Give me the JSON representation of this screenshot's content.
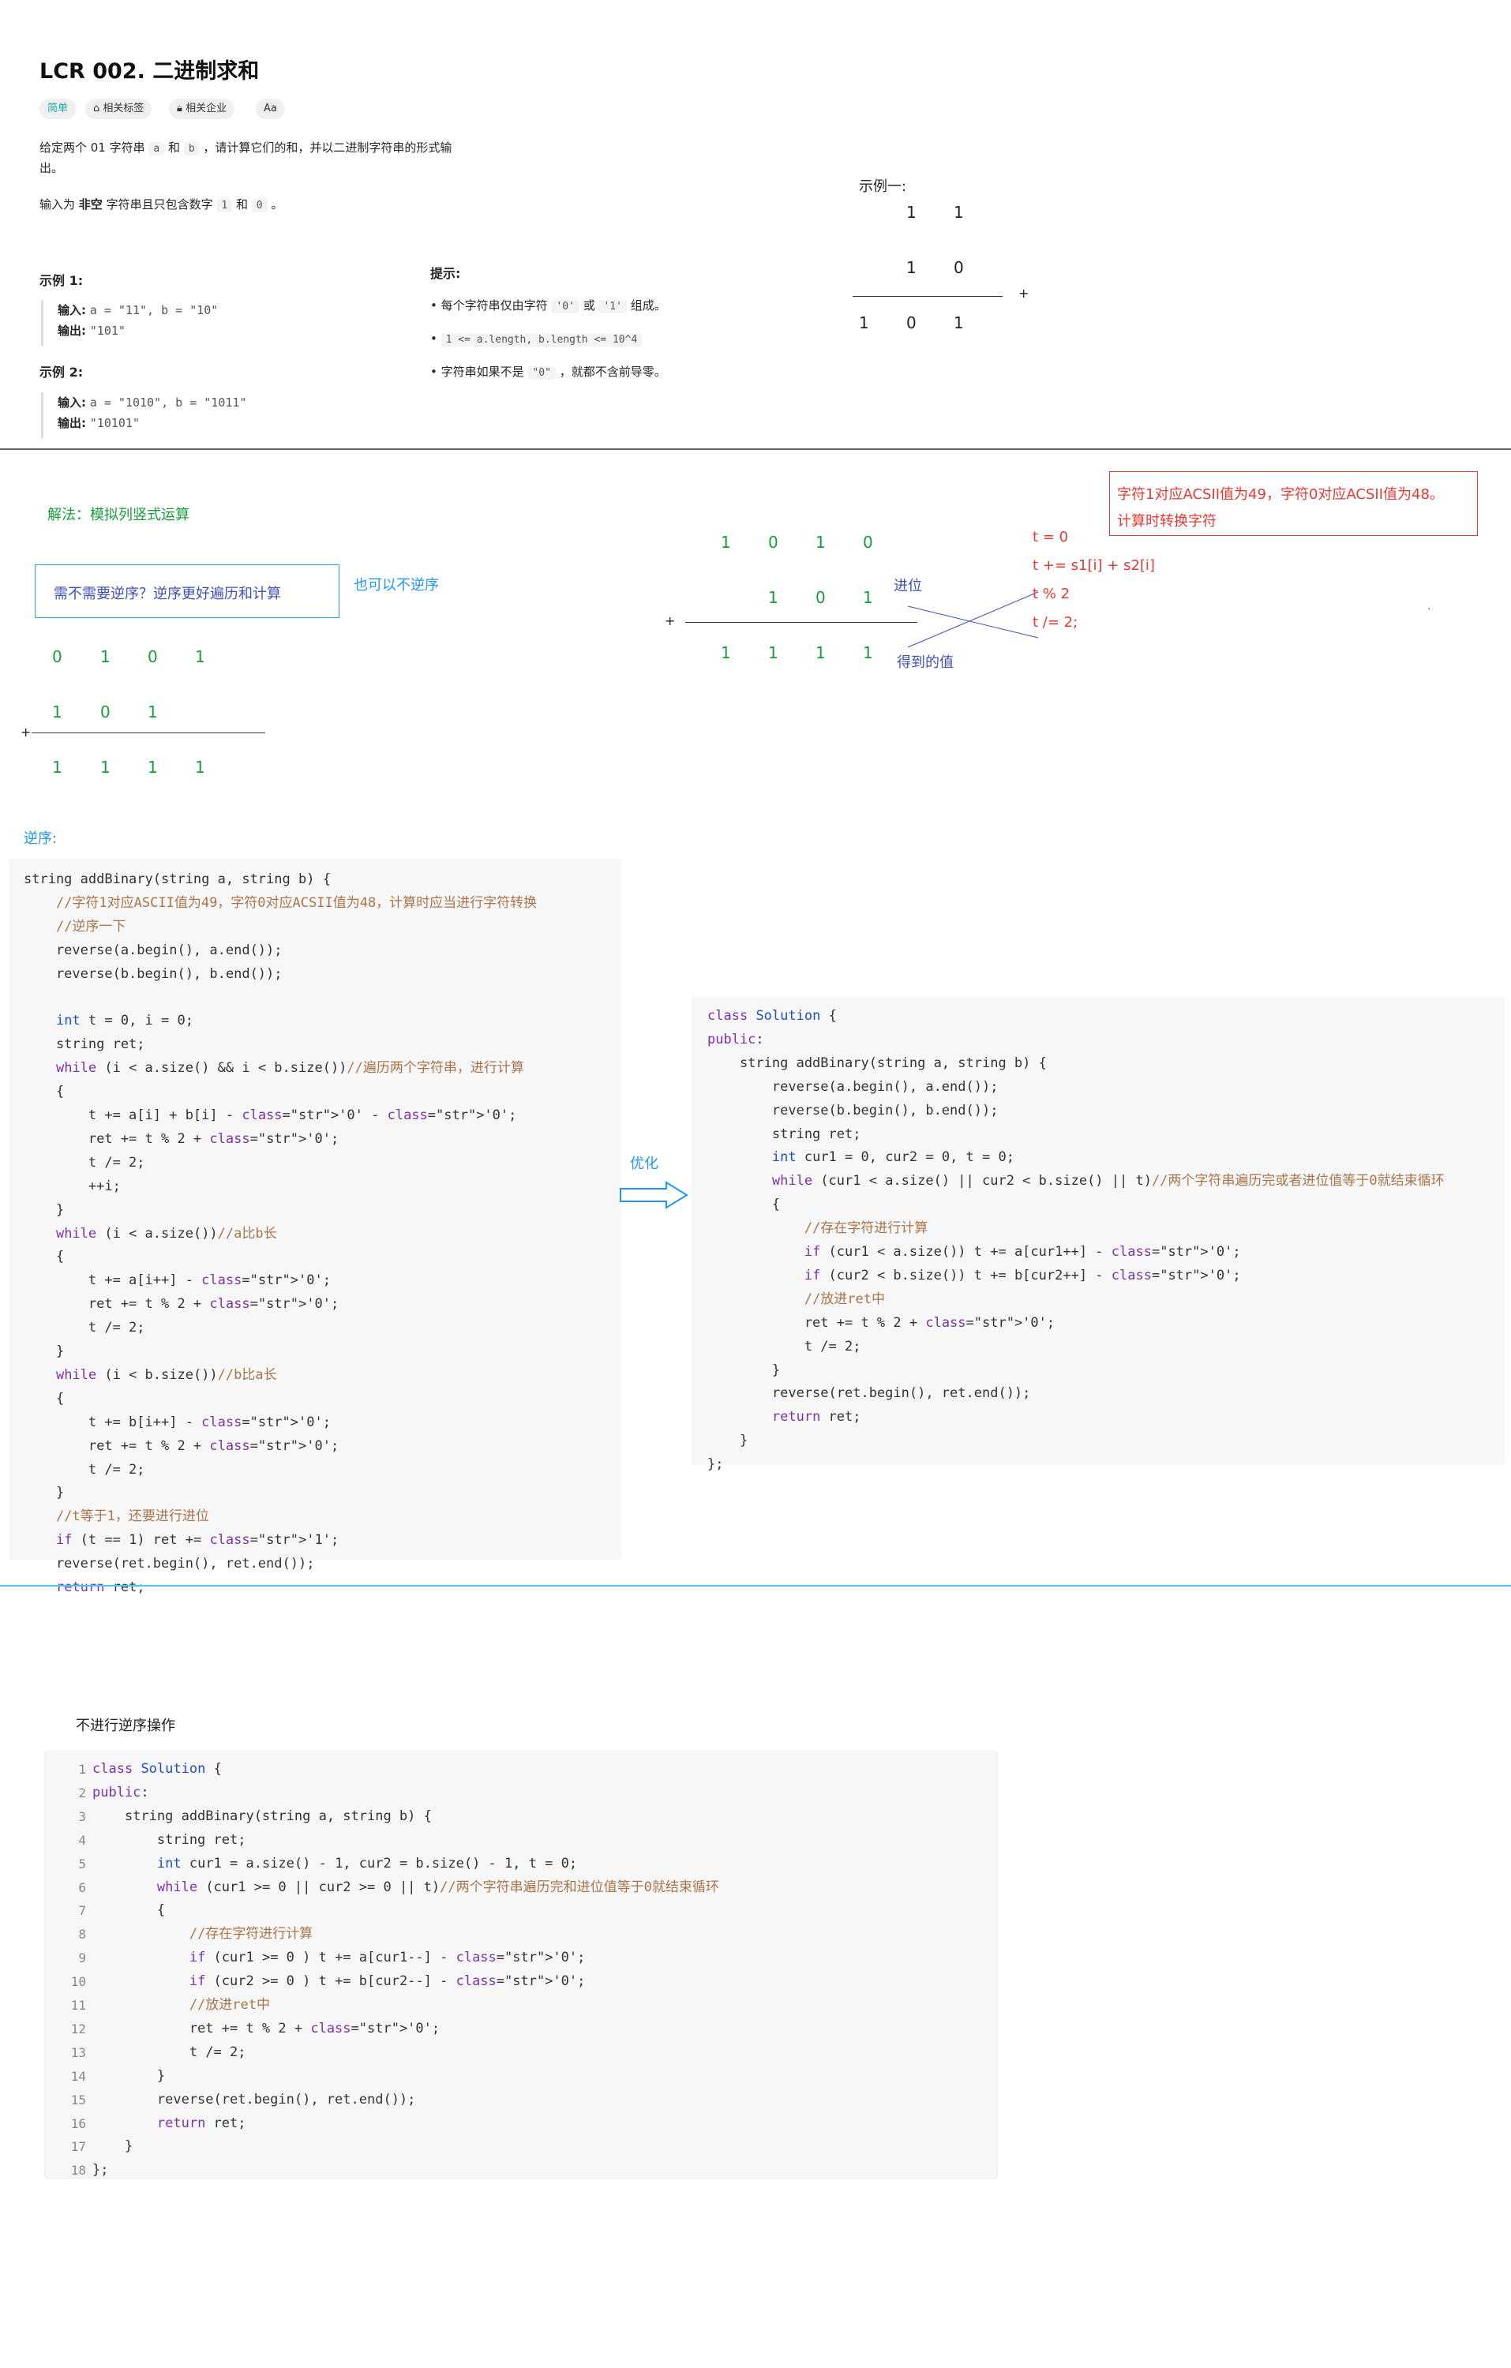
{
  "problem": {
    "title": "LCR 002. 二进制求和",
    "tags": [
      "简单",
      "相关标签",
      "相关企业",
      "Aa"
    ],
    "desc_1a": "给定两个 01 字符串",
    "desc_a": "a",
    "desc_and": "和",
    "desc_b": "b",
    "desc_1b": "，请计算它们的和，并以二进制字符串的形式输",
    "desc_1c": "出。",
    "desc_2a": "输入为",
    "desc_2b": "非空",
    "desc_2c": "字符串且只包含数字",
    "desc_2d": "1",
    "desc_2e": "和",
    "desc_2f": "0",
    "desc_2g": "。",
    "example1_title": "示例 1:",
    "example1_input_label": "输入:",
    "example1_input": "a = \"11\", b = \"10\"",
    "example1_output_label": "输出:",
    "example1_output": "\"101\"",
    "example2_title": "示例 2:",
    "example2_input_label": "输入:",
    "example2_input": "a = \"1010\", b = \"1011\"",
    "example2_output_label": "输出:",
    "example2_output": "\"10101\"",
    "hint_title": "提示:",
    "hint1a": "每个字符串仅由字符",
    "hint1b": "'0'",
    "hint1c": "或",
    "hint1d": "'1'",
    "hint1e": "组成。",
    "hint2": "1 <= a.length, b.length <= 10^4",
    "hint3a": "字符串如果不是",
    "hint3b": "\"0\"",
    "hint3c": "，就都不含前导零。"
  },
  "example_top": {
    "label": "示例一:",
    "row1": [
      "1",
      "1"
    ],
    "row2": [
      "1",
      "0"
    ],
    "plus": "+",
    "result": [
      "1",
      "0",
      "1"
    ]
  },
  "analysis": {
    "method": "解法：模拟列竖式运算",
    "question_box": "需不需要逆序？逆序更好遍历和计算",
    "no_reverse": "也可以不逆序",
    "left_row1": [
      "0",
      "1",
      "0",
      "1"
    ],
    "left_row2": [
      "1",
      "0",
      "1"
    ],
    "left_plus": "+",
    "left_result": [
      "1",
      "1",
      "1",
      "1"
    ],
    "mid_row1": [
      "1",
      "0",
      "1",
      "0"
    ],
    "mid_row2": [
      "1",
      "0",
      "1"
    ],
    "mid_plus": "+",
    "mid_result": [
      "1",
      "1",
      "1",
      "1"
    ],
    "carry_label": "进位",
    "value_label": "得到的值",
    "formula": [
      "t = 0",
      "t += s1[i] + s2[i]",
      "t % 2",
      "t /= 2;"
    ],
    "red_note_1": "字符1对应ACSII值为49，字符0对应ACSII值为48。",
    "red_note_2": "计算时转换字符",
    "dot": "."
  },
  "reverse_section": {
    "label": "逆序:",
    "optimize_label": "优化"
  },
  "no_reverse_section": {
    "label": "不进行逆序操作"
  }
}
